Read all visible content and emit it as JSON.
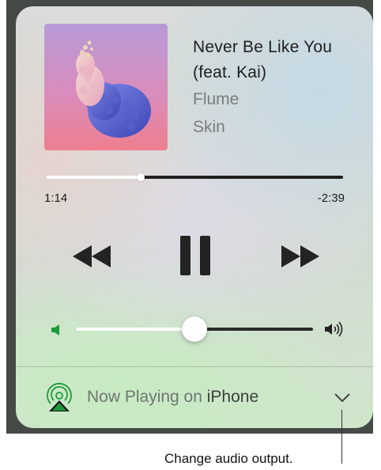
{
  "now_playing": {
    "track_title": "Never Be Like You (feat. Kai)",
    "artist": "Flume",
    "album": "Skin"
  },
  "playback": {
    "elapsed": "1:14",
    "remaining": "-2:39",
    "progress_fraction": 0.32
  },
  "controls": {
    "rewind_icon": "rewind-icon",
    "pause_icon": "pause-icon",
    "fast_forward_icon": "fast-forward-icon"
  },
  "volume": {
    "level_fraction": 0.5,
    "low_icon": "speaker-low-icon",
    "high_icon": "speaker-high-icon"
  },
  "output": {
    "prefix": "Now Playing on ",
    "device": "iPhone",
    "icon": "airplay-icon",
    "chevron_icon": "chevron-down-icon"
  },
  "annotation": {
    "callout": "Change audio output."
  },
  "colors": {
    "accent_green": "#1f9a3a",
    "control_dark": "#232323",
    "secondary_text": "#7a7d7c"
  }
}
